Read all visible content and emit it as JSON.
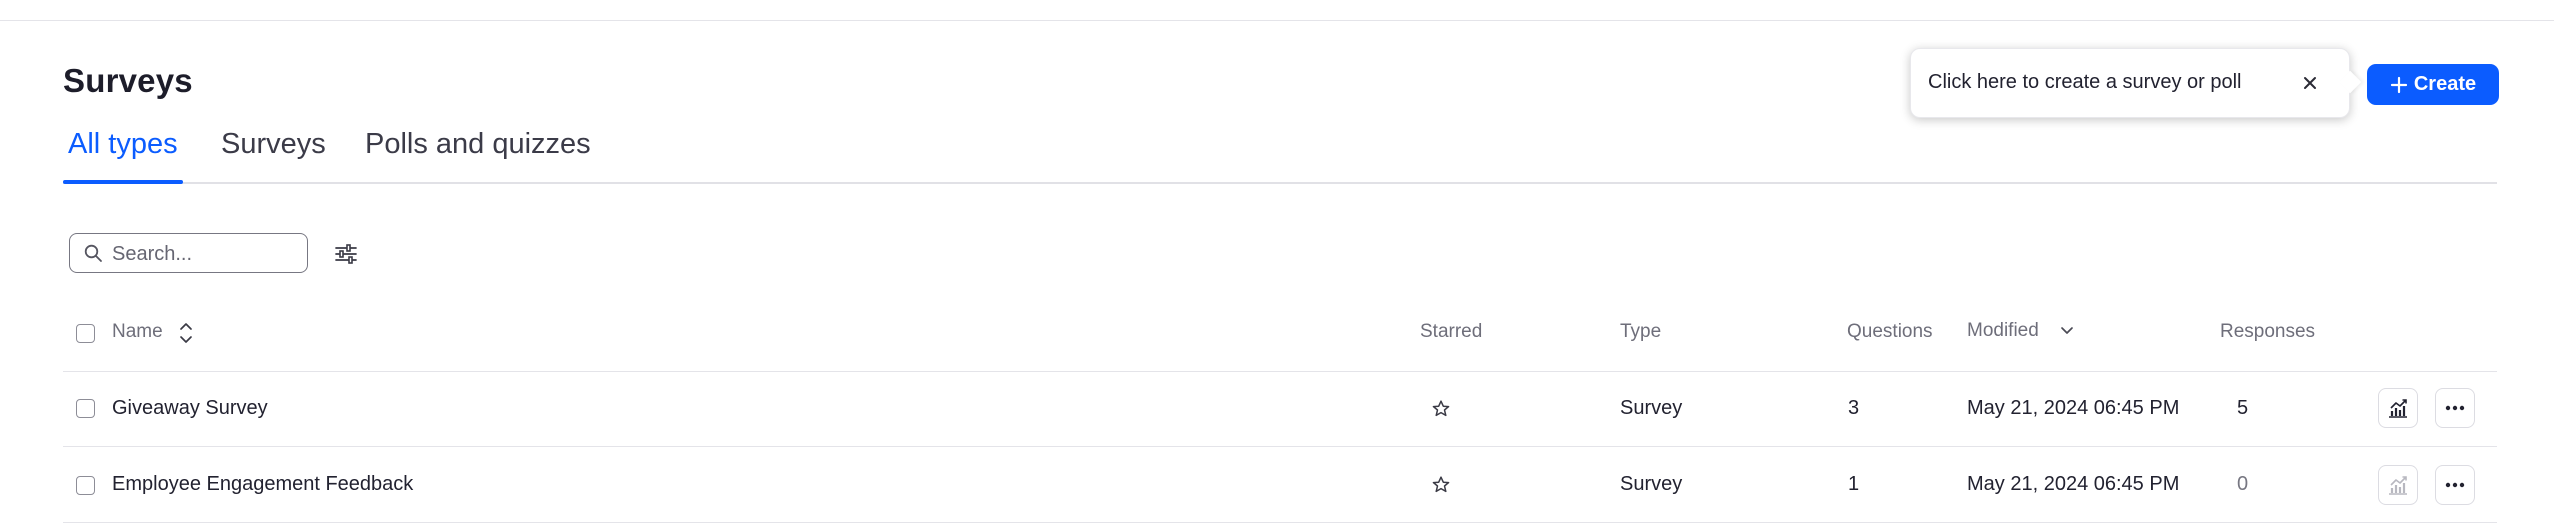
{
  "header": {
    "title": "Surveys"
  },
  "tabs": [
    {
      "label": "All types",
      "active": true
    },
    {
      "label": "Surveys",
      "active": false
    },
    {
      "label": "Polls and quizzes",
      "active": false
    }
  ],
  "tooltip": {
    "text": "Click here to create a survey or poll"
  },
  "create_button": {
    "label": "Create"
  },
  "search": {
    "placeholder": "Search...",
    "value": ""
  },
  "table": {
    "columns": {
      "name": "Name",
      "starred": "Starred",
      "type": "Type",
      "questions": "Questions",
      "modified": "Modified",
      "responses": "Responses"
    },
    "rows": [
      {
        "name": "Giveaway Survey",
        "type": "Survey",
        "questions": "3",
        "modified": "May 21, 2024 06:45 PM",
        "responses": "5",
        "starred": false
      },
      {
        "name": "Employee Engagement Feedback",
        "type": "Survey",
        "questions": "1",
        "modified": "May 21, 2024 06:45 PM",
        "responses": "0",
        "starred": false
      }
    ]
  },
  "colors": {
    "accent": "#0b5cff",
    "text": "#222230",
    "muted": "#6e6e7a",
    "border": "#e4e4e9"
  }
}
